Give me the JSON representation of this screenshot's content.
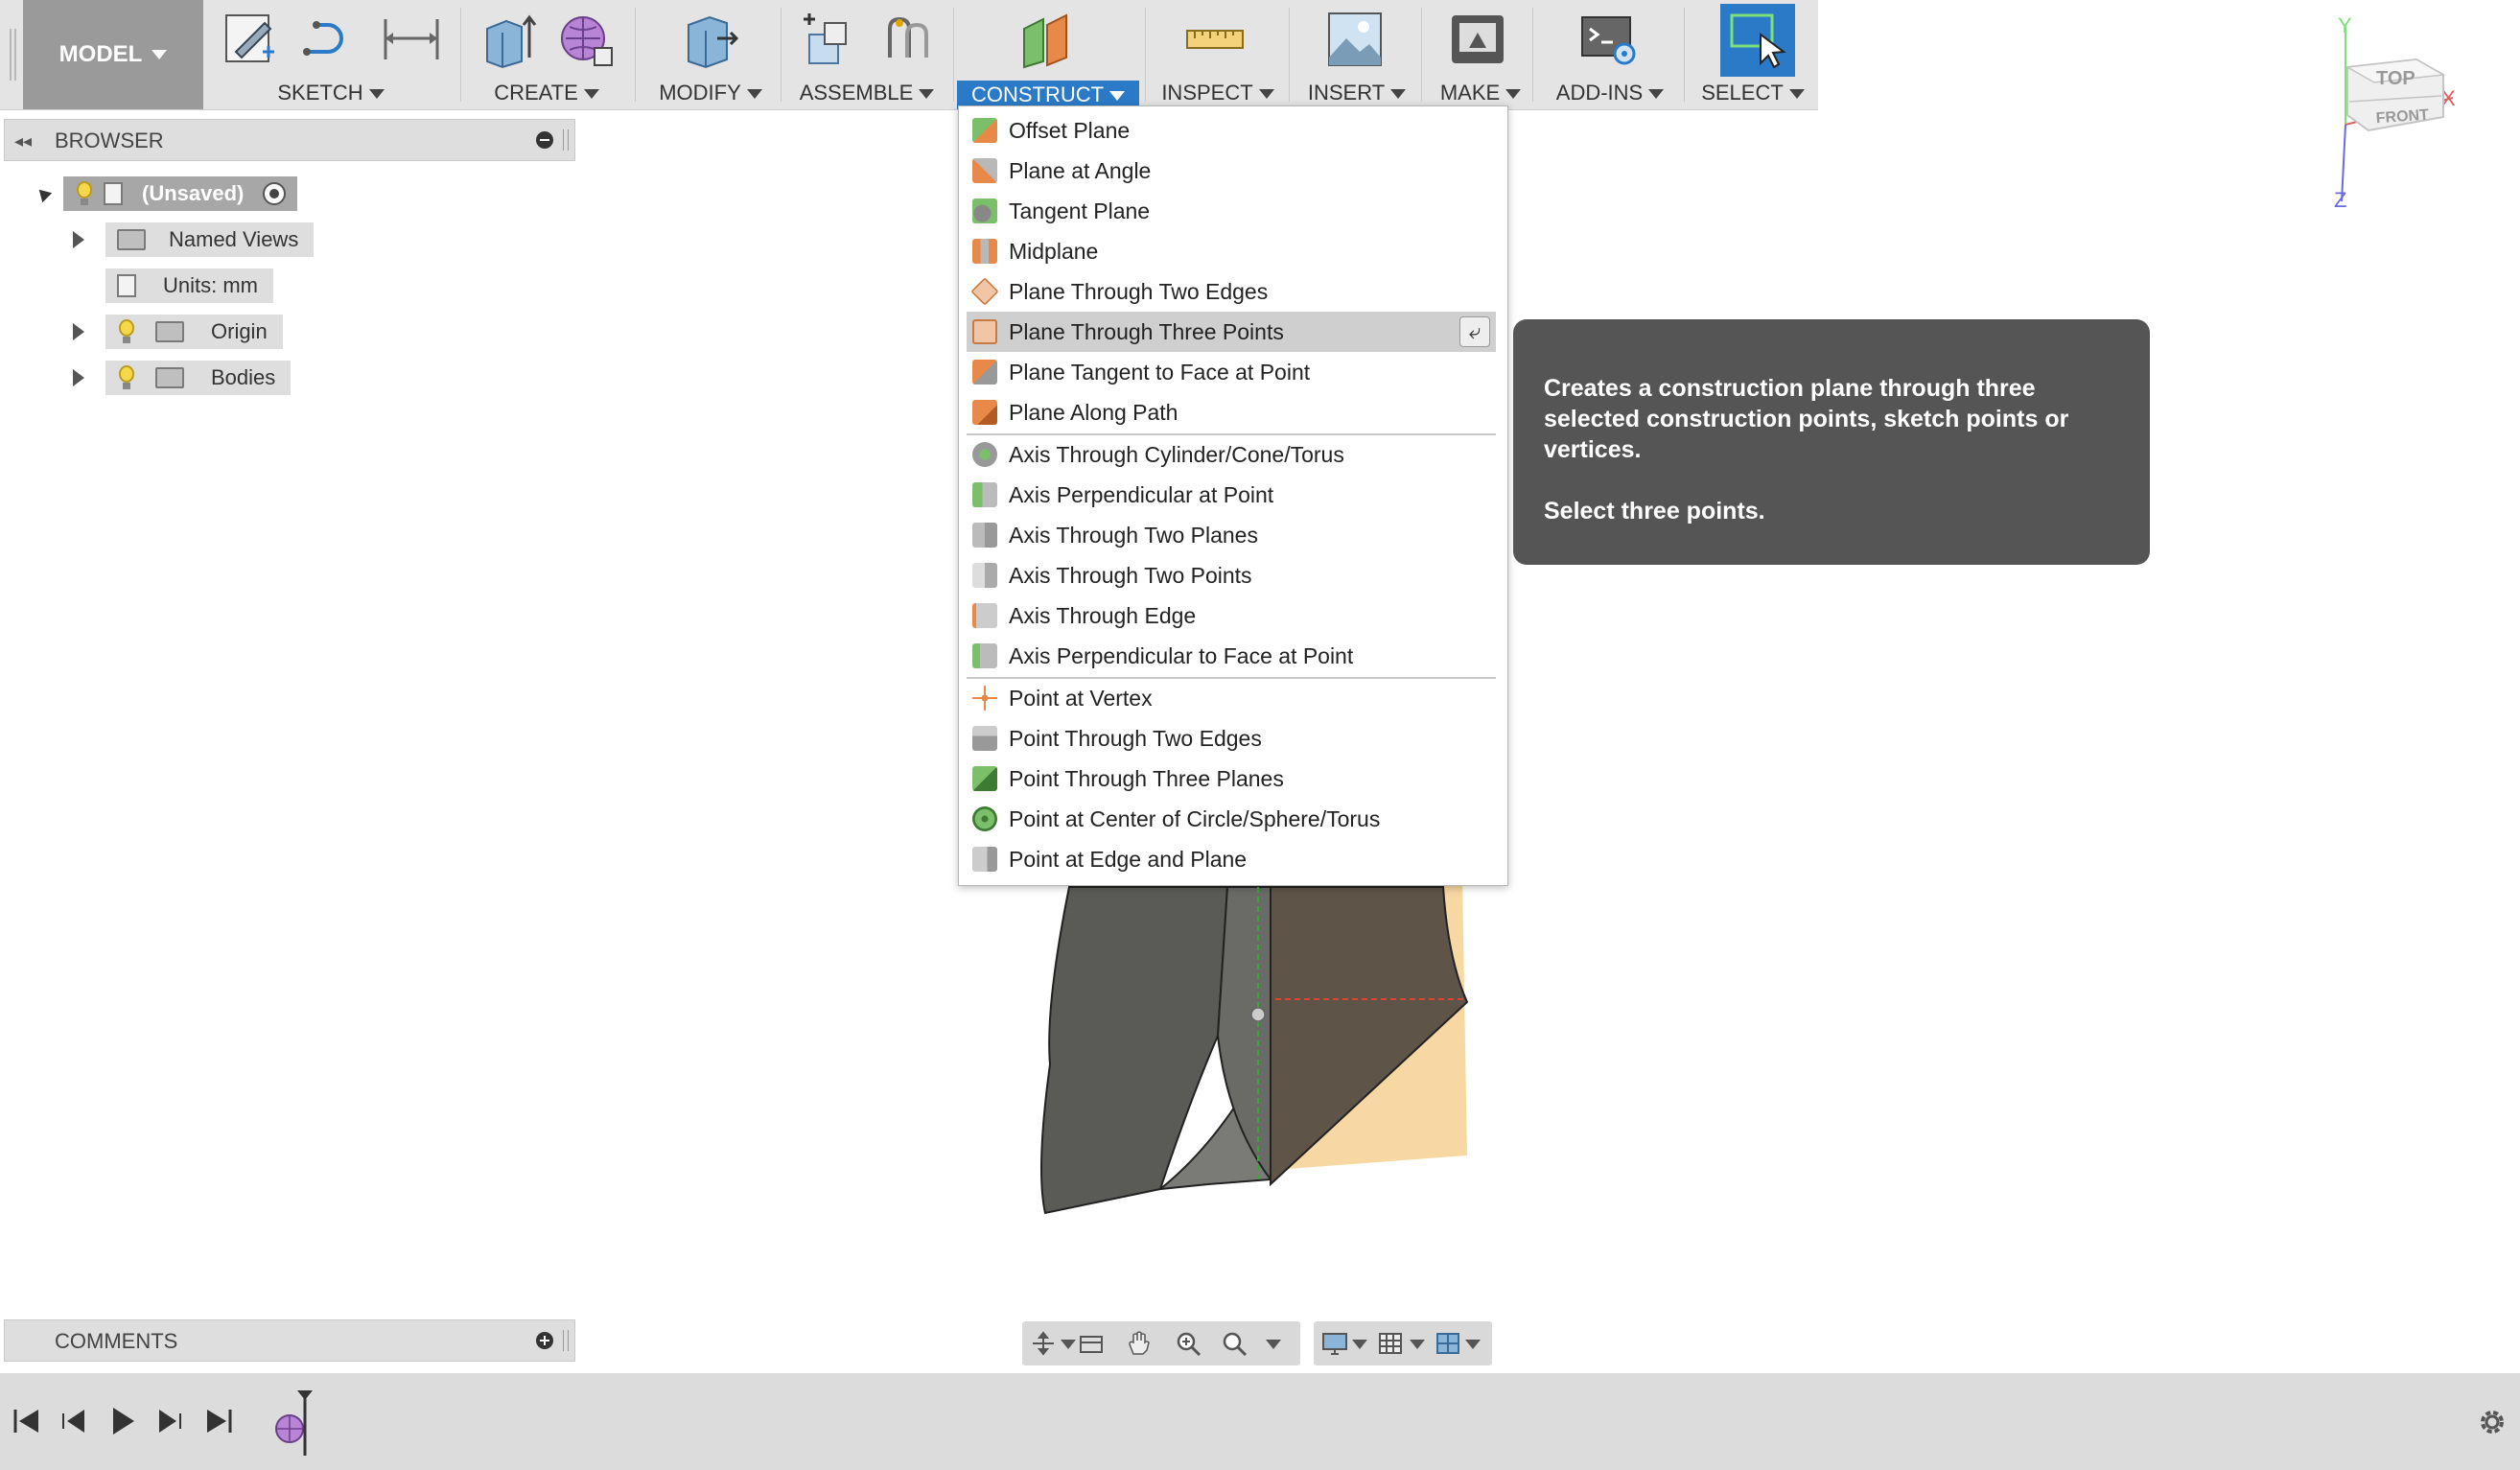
{
  "toolbar": {
    "model_label": "MODEL",
    "groups": {
      "sketch": "SKETCH",
      "create": "CREATE",
      "modify": "MODIFY",
      "assemble": "ASSEMBLE",
      "construct": "CONSTRUCT",
      "inspect": "INSPECT",
      "insert": "INSERT",
      "make": "MAKE",
      "addins": "ADD-INS",
      "select": "SELECT"
    },
    "active_group": "CONSTRUCT",
    "accent_color": "#2a7ac8"
  },
  "browser": {
    "title": "BROWSER",
    "items": [
      {
        "label": "(Unsaved)",
        "icon": "document-icon",
        "active": true
      },
      {
        "label": "Named Views",
        "icon": "folder-icon"
      },
      {
        "label": "Units: mm",
        "icon": "document-icon"
      },
      {
        "label": "Origin",
        "icon": "folder-icon"
      },
      {
        "label": "Bodies",
        "icon": "folder-icon"
      }
    ]
  },
  "comments": {
    "title": "COMMENTS"
  },
  "construct_menu": {
    "items": [
      {
        "label": "Offset Plane",
        "icon": "offset-plane-icon"
      },
      {
        "label": "Plane at Angle",
        "icon": "plane-angle-icon"
      },
      {
        "label": "Tangent Plane",
        "icon": "tangent-plane-icon"
      },
      {
        "label": "Midplane",
        "icon": "midplane-icon"
      },
      {
        "label": "Plane Through Two Edges",
        "icon": "plane-two-edges-icon"
      },
      {
        "label": "Plane Through Three Points",
        "icon": "plane-three-points-icon",
        "highlighted": true
      },
      {
        "label": "Plane Tangent to Face at Point",
        "icon": "plane-tangent-face-icon"
      },
      {
        "label": "Plane Along Path",
        "icon": "plane-along-path-icon"
      },
      {
        "label": "Axis Through Cylinder/Cone/Torus",
        "icon": "axis-cylinder-icon"
      },
      {
        "label": "Axis Perpendicular at Point",
        "icon": "axis-perp-point-icon"
      },
      {
        "label": "Axis Through Two Planes",
        "icon": "axis-two-planes-icon"
      },
      {
        "label": "Axis Through Two Points",
        "icon": "axis-two-points-icon"
      },
      {
        "label": "Axis Through Edge",
        "icon": "axis-edge-icon"
      },
      {
        "label": "Axis Perpendicular to Face at Point",
        "icon": "axis-perp-face-icon"
      },
      {
        "label": "Point at Vertex",
        "icon": "point-vertex-icon"
      },
      {
        "label": "Point Through Two Edges",
        "icon": "point-two-edges-icon"
      },
      {
        "label": "Point Through Three Planes",
        "icon": "point-three-planes-icon"
      },
      {
        "label": "Point at Center of Circle/Sphere/Torus",
        "icon": "point-center-icon"
      },
      {
        "label": "Point at Edge and Plane",
        "icon": "point-edge-plane-icon"
      }
    ]
  },
  "tooltip": {
    "description": "Creates a construction plane through three selected construction points, sketch points or vertices.",
    "instruction": "Select three points."
  },
  "viewcube": {
    "top": "TOP",
    "front": "FRONT",
    "axis_x": "X",
    "axis_y": "Y",
    "axis_z": "Z"
  }
}
